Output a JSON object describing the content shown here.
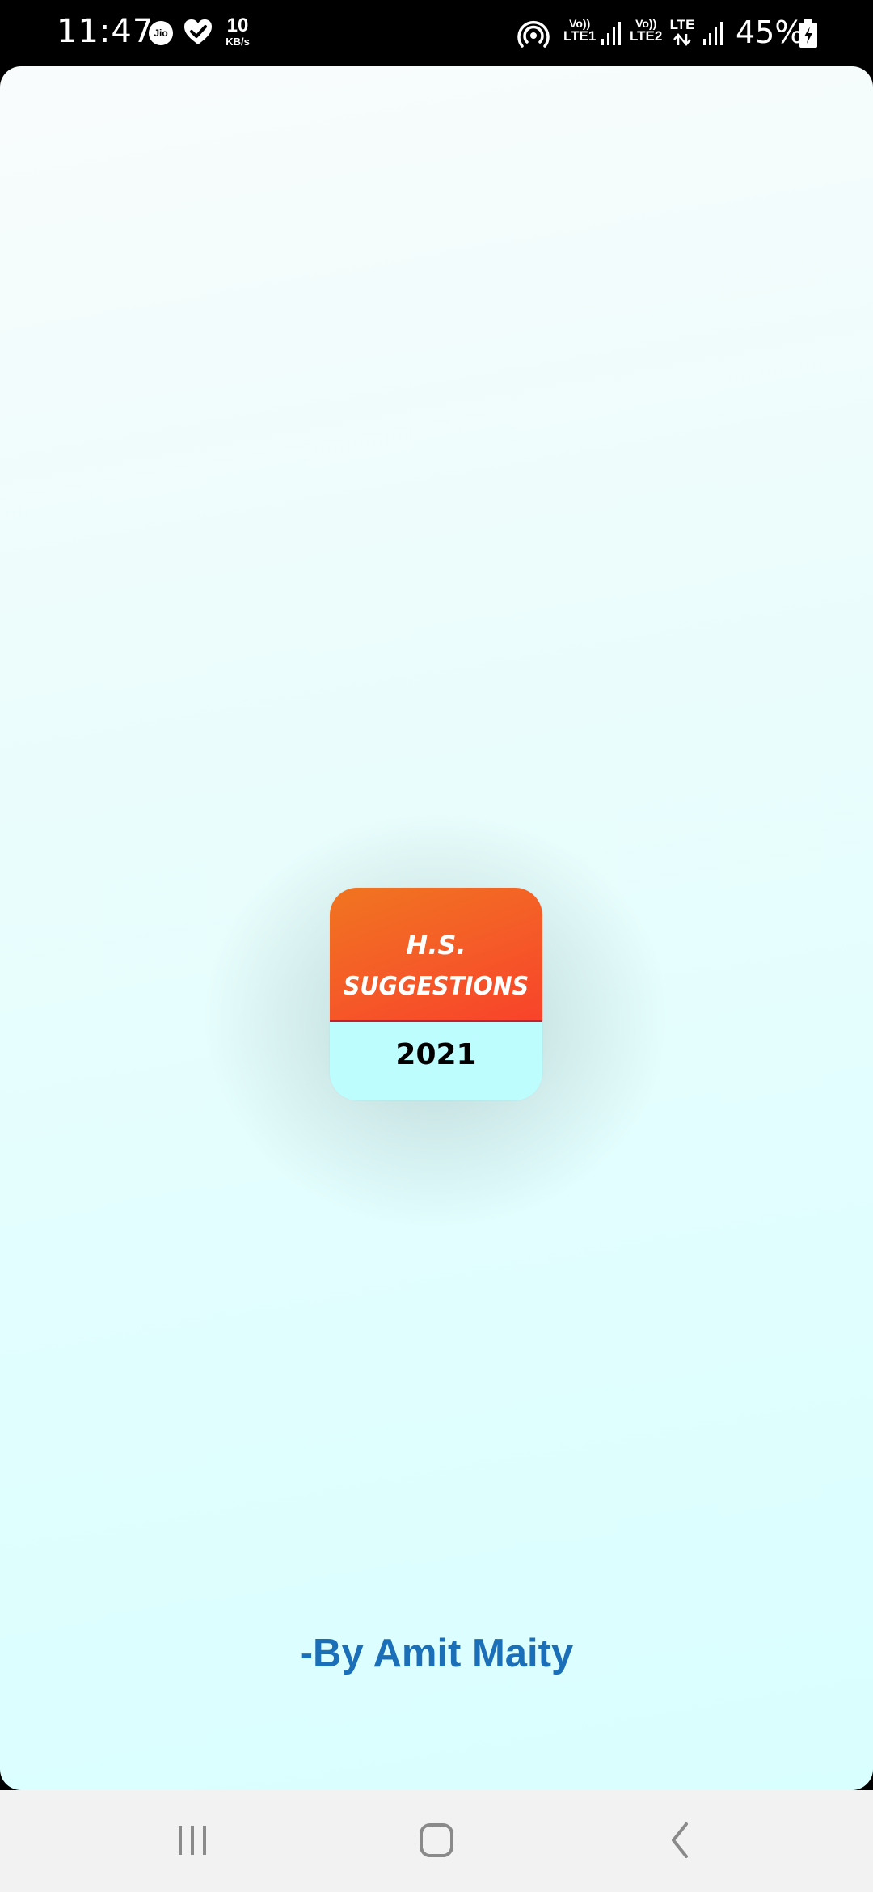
{
  "status_bar": {
    "time": "11:47",
    "carrier_icon_text": "Jio",
    "net_speed_value": "10",
    "net_speed_unit": "KB/s",
    "sim1_top": "Vo))",
    "sim1_bottom": "LTE1",
    "sim2_top": "Vo))",
    "sim2_bottom": "LTE2",
    "data_type": "LTE",
    "battery_percent": "45%",
    "icons": [
      "jio-icon",
      "health-check-icon",
      "hotspot-icon",
      "signal-icon",
      "signal-icon",
      "data-arrows-icon",
      "battery-charging-icon"
    ]
  },
  "splash": {
    "logo_line1": "H.S.",
    "logo_line2": "SUGGESTIONS",
    "logo_year": "2021",
    "author": "-By Amit Maity"
  },
  "colors": {
    "logo_top": "#f55a28",
    "logo_bottom": "#bdfdfe",
    "author_text": "#1b6fb8",
    "background": "#e1fefe"
  },
  "nav_bar": {
    "buttons": [
      "recent-apps-icon",
      "home-icon",
      "back-icon"
    ]
  }
}
